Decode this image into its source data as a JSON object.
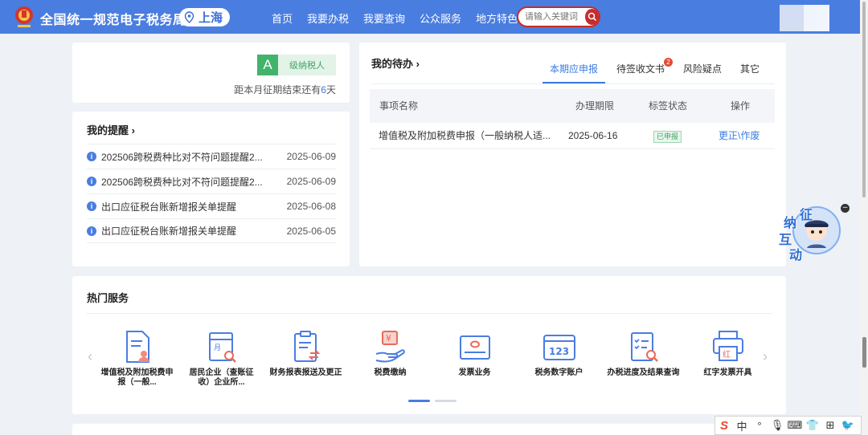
{
  "header": {
    "site_title": "全国统一规范电子税务局",
    "region": "上海",
    "nav": [
      "首页",
      "我要办税",
      "我要查询",
      "公众服务",
      "地方特色"
    ],
    "search_placeholder": "请输入关键词"
  },
  "taxpayer": {
    "grade_letter": "A",
    "grade_label": "级纳税人",
    "period_prefix": "距本月征期结束还有",
    "period_days": "6",
    "period_suffix": "天"
  },
  "reminders": {
    "title": "我的提醒 ›",
    "items": [
      {
        "text": "202506跨税费种比对不符问题提醒2...",
        "date": "2025-06-09"
      },
      {
        "text": "202506跨税费种比对不符问题提醒2...",
        "date": "2025-06-09"
      },
      {
        "text": "出口应征税台账新增报关单提醒",
        "date": "2025-06-08"
      },
      {
        "text": "出口应征税台账新增报关单提醒",
        "date": "2025-06-05"
      }
    ]
  },
  "todo": {
    "title": "我的待办 ›",
    "tabs": [
      {
        "label": "本期应申报",
        "badge": ""
      },
      {
        "label": "待签收文书",
        "badge": "2"
      },
      {
        "label": "风险疑点",
        "badge": ""
      },
      {
        "label": "其它",
        "badge": ""
      }
    ],
    "columns": [
      "事项名称",
      "办理期限",
      "标签状态",
      "操作"
    ],
    "rows": [
      {
        "name": "增值税及附加税费申报（一般纳税人适...",
        "deadline": "2025-06-16",
        "status": "已申报",
        "action": "更正\\作废"
      }
    ]
  },
  "hot_services": {
    "title": "热门服务",
    "items": [
      {
        "label": "增值税及附加税费申报（一般...",
        "icon": "declaration-doc-icon"
      },
      {
        "label": "居民企业（查账征收）企业所...",
        "icon": "calendar-search-icon"
      },
      {
        "label": "财务报表报送及更正",
        "icon": "clipboard-exchange-icon"
      },
      {
        "label": "税费缴纳",
        "icon": "yuan-hand-icon"
      },
      {
        "label": "发票业务",
        "icon": "invoice-icon"
      },
      {
        "label": "税务数字账户",
        "icon": "digital-account-icon"
      },
      {
        "label": "办税进度及结果查询",
        "icon": "checklist-search-icon"
      },
      {
        "label": "红字发票开具",
        "icon": "red-invoice-printer-icon"
      }
    ]
  },
  "mascot": {
    "chars": [
      "征",
      "纳",
      "互",
      "动"
    ]
  },
  "ime": {
    "items": [
      "S",
      "中",
      "°",
      "🎙",
      "⌨",
      "👕",
      "⊞",
      "🐦"
    ]
  },
  "colors": {
    "primary": "#4a7de0",
    "danger": "#c62b2b",
    "success": "#42b36b"
  }
}
